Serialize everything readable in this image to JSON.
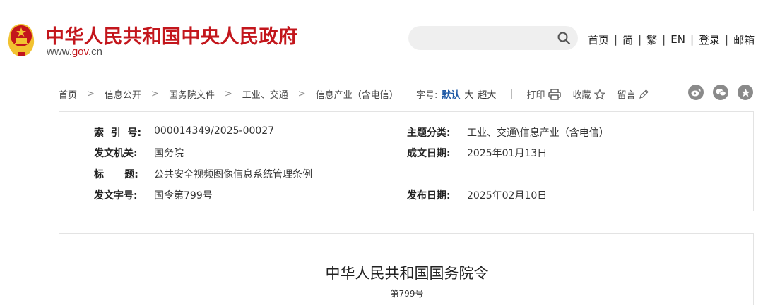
{
  "header": {
    "site_title": "中华人民共和国中央人民政府",
    "url_prefix": "www.",
    "url_mid": "gov",
    "url_suffix": ".cn",
    "search_placeholder": "",
    "nav": [
      "首页",
      "简",
      "繁",
      "EN",
      "登录",
      "邮箱"
    ],
    "nav_sep": "|"
  },
  "breadcrumb": [
    "首页",
    "信息公开",
    "国务院文件",
    "工业、交通",
    "信息产业（含电信）"
  ],
  "breadcrumb_sep": ">",
  "tools": {
    "font_size_label": "字号:",
    "font_sizes": [
      "默认",
      "大",
      "超大"
    ],
    "active_font_size": "默认",
    "print": "打印",
    "favorite": "收藏",
    "comment": "留言"
  },
  "info": {
    "index_label": "索  引  号:",
    "index_value": "000014349/2025-00027",
    "topic_label": "主题分类:",
    "topic_value": "工业、交通\\信息产业（含电信）",
    "issuer_label": "发文机关:",
    "issuer_value": "国务院",
    "date_written_label": "成文日期:",
    "date_written_value": "2025年01月13日",
    "title_label": "标      题:",
    "title_value": "公共安全视频图像信息系统管理条例",
    "doc_no_label": "发文字号:",
    "doc_no_value": "国令第799号",
    "publish_date_label": "发布日期:",
    "publish_date_value": "2025年02月10日"
  },
  "document": {
    "heading": "中华人民共和国国务院令",
    "number": "第799号"
  },
  "colors": {
    "brand_red": "#c3161c",
    "emblem_gold": "#f2c230",
    "link_blue": "#1f5aa6",
    "share_gray": "#8a8a8a"
  }
}
